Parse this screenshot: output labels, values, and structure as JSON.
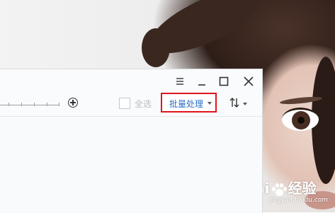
{
  "window": {
    "toolbar": {
      "select_all_label": "全选",
      "batch_button_label": "批量处理"
    }
  },
  "watermark": {
    "brand_left": "Bai",
    "brand_right": "经验",
    "url": "jingyan.baidu.com"
  },
  "colors": {
    "highlight_border": "#e0141e",
    "batch_text": "#2b6fc9",
    "disabled_text": "#b8bcc2"
  },
  "icons": [
    "menu-icon",
    "minimize-icon",
    "maximize-icon",
    "close-icon",
    "zoom-in-icon",
    "chevron-down-icon",
    "sort-icon"
  ]
}
